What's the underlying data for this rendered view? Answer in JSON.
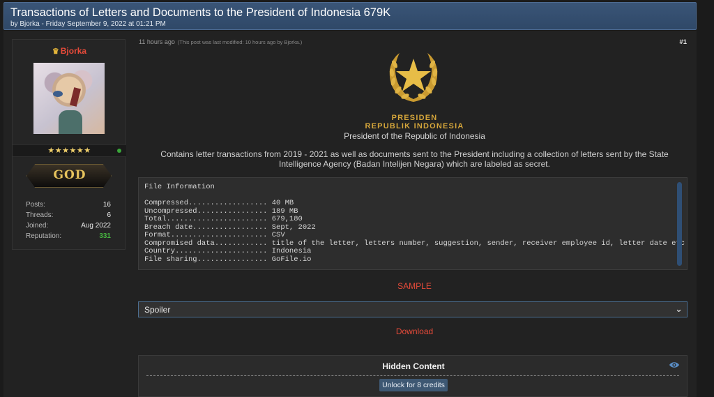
{
  "thread": {
    "title": "Transactions of Letters and Documents to the President of Indonesia 679K",
    "meta": "by Bjorka - Friday September 9, 2022 at 01:21 PM"
  },
  "user": {
    "name": "Bjorka",
    "stars": "★★★★★★",
    "rank": "GOD",
    "stats": [
      {
        "key": "Posts:",
        "value": "16"
      },
      {
        "key": "Threads:",
        "value": "6"
      },
      {
        "key": "Joined:",
        "value": "Aug 2022"
      },
      {
        "key": "Reputation:",
        "value": "331"
      }
    ]
  },
  "post": {
    "time": "11 hours ago",
    "modified": "(This post was last modified: 10 hours ago by Bjorka.)",
    "number": "#1",
    "emblem_line1": "PRESIDEN",
    "emblem_line2": "REPUBLIK INDONESIA",
    "emblem_sub": "President of the Republic of Indonesia",
    "description": "Contains letter transactions from 2019 - 2021 as well as documents sent to the President including a collection of letters sent by the State Intelligence Agency (Badan Intelijen Negara) which are labeled as secret.",
    "code_lines": [
      "File Information",
      "",
      "Compressed.................. 40 MB",
      "Uncompressed................ 189 MB",
      "Total....................... 679,180",
      "Breach date................. Sept, 2022",
      "Format...................... CSV",
      "Compromised data............ title of the letter, letters number, suggestion, sender, receiver employee id, letter date etc",
      "Country..................... Indonesia",
      "File sharing................ GoFile.io"
    ],
    "sample_label": "SAMPLE",
    "spoiler_label": "Spoiler",
    "download_label": "Download",
    "hidden_title": "Hidden Content",
    "unlock_label": "Unlock for 8 credits"
  },
  "colors": {
    "accent_red": "#e84b3a",
    "emblem_gold": "#d5a63b",
    "header_blue": "#3a5577",
    "reputation_green": "#47b541"
  },
  "icons": [
    "crown-icon",
    "online-status-icon",
    "garuda-star-emblem-icon",
    "chevron-down-icon",
    "eye-icon"
  ]
}
